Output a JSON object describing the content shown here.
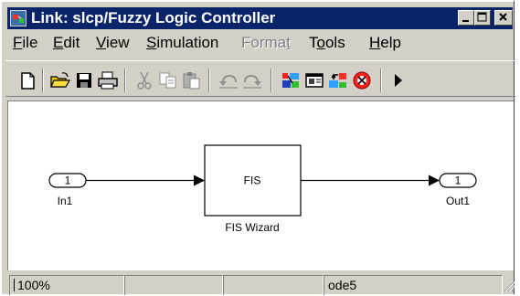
{
  "window": {
    "title": "Link: slcp/Fuzzy Logic Controller"
  },
  "menu": {
    "file": "File",
    "edit": "Edit",
    "view": "View",
    "simulation": "Simulation",
    "format": "Format",
    "tools": "Tools",
    "help": "Help"
  },
  "toolbar": {
    "icons": [
      "new-icon",
      "open-icon",
      "save-icon",
      "print-icon",
      "cut-icon",
      "copy-icon",
      "paste-icon",
      "undo-icon",
      "redo-icon",
      "library-browser-icon",
      "model-properties-icon",
      "go-to-parent-icon",
      "debug-icon",
      "start-simulation-icon"
    ]
  },
  "diagram": {
    "inport": {
      "number": "1",
      "name": "In1"
    },
    "fis_block": {
      "text": "FIS",
      "name": "FIS Wizard"
    },
    "outport": {
      "number": "1",
      "name": "Out1"
    }
  },
  "status": {
    "zoom": "100%",
    "solver": "ode5"
  },
  "colors": {
    "titlebar": "#0a246a",
    "chrome": "#d4d0c8",
    "canvas": "#ffffff"
  }
}
